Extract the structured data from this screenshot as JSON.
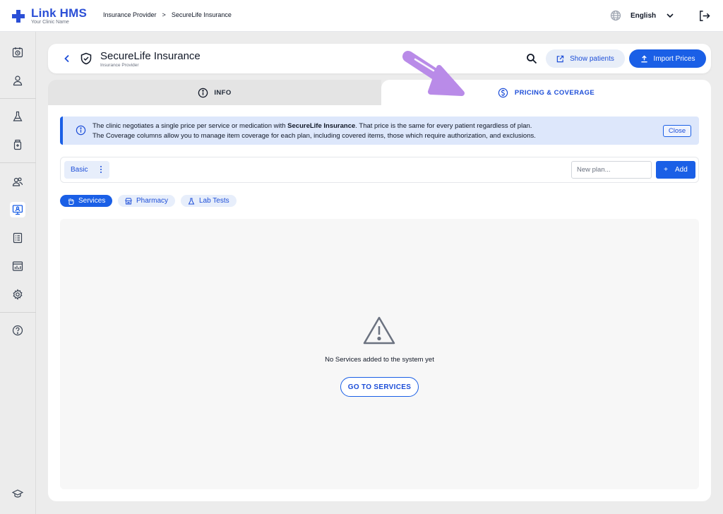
{
  "app": {
    "name": "Link HMS",
    "clinic": "Your Clinic Name"
  },
  "breadcrumb": {
    "parent": "Insurance Provider",
    "separator": ">",
    "current": "SecureLife Insurance"
  },
  "topbar": {
    "language": "English"
  },
  "header": {
    "title": "SecureLife Insurance",
    "subtitle": "Insurance Provider",
    "show_patients_label": "Show patients",
    "import_prices_label": "Import Prices"
  },
  "tabs": [
    {
      "label": "INFO",
      "active": false
    },
    {
      "label": "PRICING & COVERAGE",
      "active": true
    }
  ],
  "banner": {
    "line1_before": "The clinic negotiates a single price per service or medication with ",
    "line1_bold": "SecureLife Insurance",
    "line1_after": ". That price is the same for every patient regardless of plan.",
    "line2": "The Coverage columns allow you to manage item coverage for each plan, including covered items, those which require authorization, and exclusions.",
    "close_label": "Close"
  },
  "plans": {
    "items": [
      "Basic"
    ],
    "new_plan_placeholder": "New plan...",
    "add_label": "Add"
  },
  "filters": [
    {
      "label": "Services",
      "active": true
    },
    {
      "label": "Pharmacy",
      "active": false
    },
    {
      "label": "Lab Tests",
      "active": false
    }
  ],
  "empty_state": {
    "message": "No Services added to the system yet",
    "button_label": "GO TO SERVICES"
  },
  "colors": {
    "primary": "#1a5fe6",
    "annotation_arrow": "#b98be8"
  }
}
